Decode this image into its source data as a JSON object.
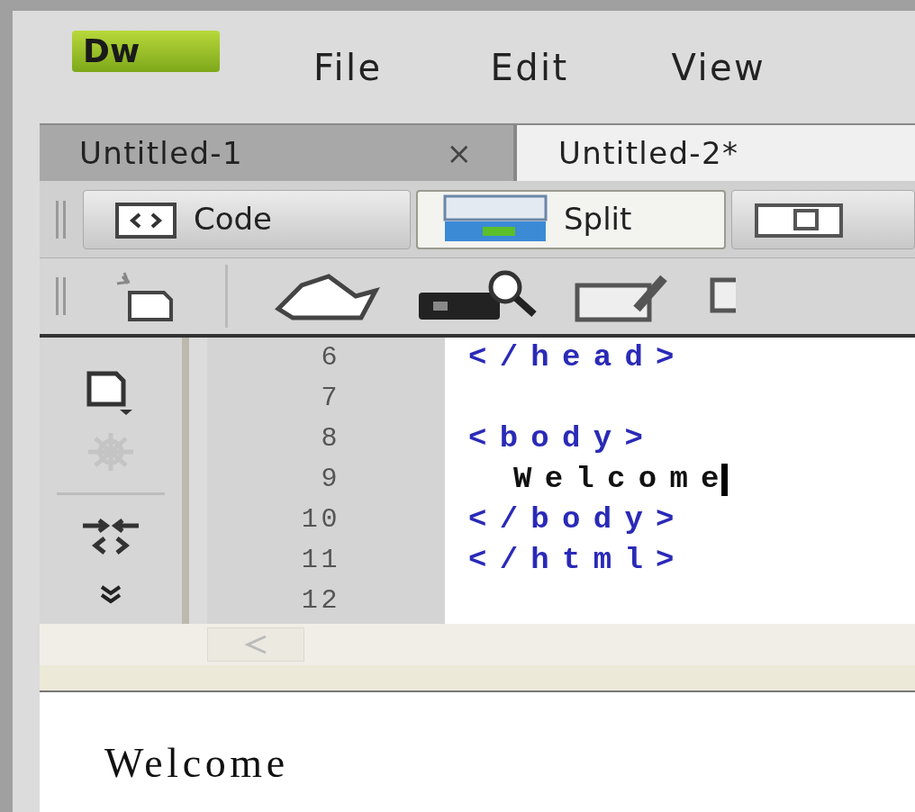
{
  "app": {
    "logo": "Dw"
  },
  "menu": [
    {
      "label": "File"
    },
    {
      "label": "Edit"
    },
    {
      "label": "View"
    }
  ],
  "tabs": [
    {
      "label": "Untitled-1",
      "close": "×",
      "selected": false
    },
    {
      "label": "Untitled-2*",
      "selected": true
    }
  ],
  "view_buttons": [
    {
      "kind": "code",
      "label": "Code",
      "selected": false
    },
    {
      "kind": "split",
      "label": "Split",
      "selected": true
    },
    {
      "kind": "design",
      "selected": false
    }
  ],
  "side_tools": [
    {
      "kind": "document",
      "disabled": false
    },
    {
      "kind": "gear",
      "disabled": true
    },
    {
      "kind": "expand",
      "disabled": false
    }
  ],
  "code_lines": [
    {
      "number": "6",
      "kind": "tag",
      "code": "</head>",
      "cursor": false
    },
    {
      "number": "7",
      "cursor": false
    },
    {
      "number": "8",
      "kind": "tag",
      "code": "<body>",
      "cursor": false
    },
    {
      "number": "9",
      "kind": "text",
      "code": "Welcome",
      "cursor": true
    },
    {
      "number": "10",
      "kind": "tag",
      "code": "</body>",
      "cursor": false
    },
    {
      "number": "11",
      "kind": "tag",
      "code": "</html>",
      "cursor": false
    },
    {
      "number": "12",
      "cursor": false
    }
  ],
  "design_view": {
    "text": "Welcome"
  }
}
